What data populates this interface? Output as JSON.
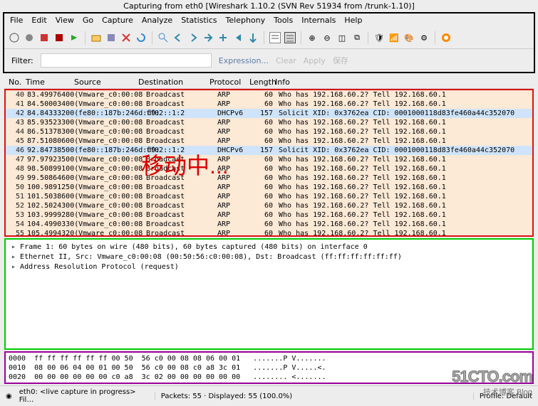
{
  "title": "Capturing from eth0   [Wireshark 1.10.2  (SVN Rev 51934 from /trunk-1.10)]",
  "menu": [
    "File",
    "Edit",
    "View",
    "Go",
    "Capture",
    "Analyze",
    "Statistics",
    "Telephony",
    "Tools",
    "Internals",
    "Help"
  ],
  "filter": {
    "label": "Filter:",
    "value": "",
    "expr": "Expression...",
    "clear": "Clear",
    "apply": "Apply",
    "save": "保存"
  },
  "columns": {
    "no": "No.",
    "time": "Time",
    "src": "Source",
    "dst": "Destination",
    "proto": "Protocol",
    "len": "Length",
    "info": "Info"
  },
  "packets": [
    {
      "no": 40,
      "time": "83.49976400(",
      "src": "Vmware_c0:00:08",
      "dst": "Broadcast",
      "proto": "ARP",
      "len": 60,
      "info": "Who has 192.168.60.2?  Tell 192.168.60.1",
      "style": ""
    },
    {
      "no": 41,
      "time": "84.50003400(",
      "src": "Vmware_c0:00:08",
      "dst": "Broadcast",
      "proto": "ARP",
      "len": 60,
      "info": "Who has 192.168.60.2?  Tell 192.168.60.1",
      "style": ""
    },
    {
      "no": 42,
      "time": "84.84333200(",
      "src": "fe80::187b:246d:d9:",
      "dst": "ff02::1:2",
      "proto": "DHCPv6",
      "len": 157,
      "info": "Solicit XID: 0x3762ea CID: 0001000118d83fe460a44c352070",
      "style": "dhcp"
    },
    {
      "no": 43,
      "time": "85.93523300(",
      "src": "Vmware_c0:00:08",
      "dst": "Broadcast",
      "proto": "ARP",
      "len": 60,
      "info": "Who has 192.168.60.2?  Tell 192.168.60.1",
      "style": ""
    },
    {
      "no": 44,
      "time": "86.51378300(",
      "src": "Vmware_c0:00:08",
      "dst": "Broadcast",
      "proto": "ARP",
      "len": 60,
      "info": "Who has 192.168.60.2?  Tell 192.168.60.1",
      "style": ""
    },
    {
      "no": 45,
      "time": "87.51080600(",
      "src": "Vmware_c0:00:08",
      "dst": "Broadcast",
      "proto": "ARP",
      "len": 60,
      "info": "Who has 192.168.60.2?  Tell 192.168.60.1",
      "style": ""
    },
    {
      "no": 46,
      "time": "92.84738500(",
      "src": "fe80::187b:246d:d9:",
      "dst": "ff02::1:2",
      "proto": "DHCPv6",
      "len": 157,
      "info": "Solicit XID: 0x3762ea CID: 0001000118d83fe460a44c352070",
      "style": "dhcp"
    },
    {
      "no": 47,
      "time": "97.97923500(",
      "src": "Vmware_c0:00:08",
      "dst": "Broadcast",
      "proto": "ARP",
      "len": 60,
      "info": "Who has 192.168.60.2?  Tell 192.168.60.1",
      "style": ""
    },
    {
      "no": 48,
      "time": "98.50899100(",
      "src": "Vmware_c0:00:08",
      "dst": "Broadcast",
      "proto": "ARP",
      "len": 60,
      "info": "Who has 192.168.60.2?  Tell 192.168.60.1",
      "style": ""
    },
    {
      "no": 49,
      "time": "99.50864600(",
      "src": "Vmware_c0:00:08",
      "dst": "Broadcast",
      "proto": "ARP",
      "len": 60,
      "info": "Who has 192.168.60.2?  Tell 192.168.60.1",
      "style": ""
    },
    {
      "no": 50,
      "time": "100.9891250(",
      "src": "Vmware_c0:00:08",
      "dst": "Broadcast",
      "proto": "ARP",
      "len": 60,
      "info": "Who has 192.168.60.2?  Tell 192.168.60.1",
      "style": ""
    },
    {
      "no": 51,
      "time": "101.5038600(",
      "src": "Vmware_c0:00:08",
      "dst": "Broadcast",
      "proto": "ARP",
      "len": 60,
      "info": "Who has 192.168.60.2?  Tell 192.168.60.1",
      "style": ""
    },
    {
      "no": 52,
      "time": "102.5024300(",
      "src": "Vmware_c0:00:08",
      "dst": "Broadcast",
      "proto": "ARP",
      "len": 60,
      "info": "Who has 192.168.60.2?  Tell 192.168.60.1",
      "style": ""
    },
    {
      "no": 53,
      "time": "103.9999280(",
      "src": "Vmware_c0:00:08",
      "dst": "Broadcast",
      "proto": "ARP",
      "len": 60,
      "info": "Who has 192.168.60.2?  Tell 192.168.60.1",
      "style": ""
    },
    {
      "no": 54,
      "time": "104.4990330(",
      "src": "Vmware_c0:00:08",
      "dst": "Broadcast",
      "proto": "ARP",
      "len": 60,
      "info": "Who has 192.168.60.2?  Tell 192.168.60.1",
      "style": ""
    },
    {
      "no": 55,
      "time": "105.4994320(",
      "src": "Vmware_c0:00:08",
      "dst": "Broadcast",
      "proto": "ARP",
      "len": 60,
      "info": "Who has 192.168.60.2?  Tell 192.168.60.1",
      "style": ""
    }
  ],
  "overlay": "移动中...",
  "details": [
    "Frame 1: 60 bytes on wire (480 bits), 60 bytes captured (480 bits) on interface 0",
    "Ethernet II, Src: Vmware_c0:00:08 (00:50:56:c0:00:08), Dst: Broadcast (ff:ff:ff:ff:ff:ff)",
    "Address Resolution Protocol (request)"
  ],
  "hex": [
    "0000  ff ff ff ff ff ff 00 50  56 c0 00 08 08 06 00 01   .......P V.......",
    "0010  08 00 06 04 00 01 00 50  56 c0 00 08 c0 a8 3c 01   .......P V.....<.",
    "0020  00 00 00 00 00 00 c0 a8  3c 02 00 00 00 00 00 00   ........ <......."
  ],
  "status": {
    "iface": "eth0: <live capture in progress> Fil…",
    "packets": "Packets: 55 · Displayed: 55 (100.0%)",
    "profile": "Profile: Default"
  },
  "watermark": {
    "big": "51CTO.com",
    "small": "技术博客      Blog"
  }
}
